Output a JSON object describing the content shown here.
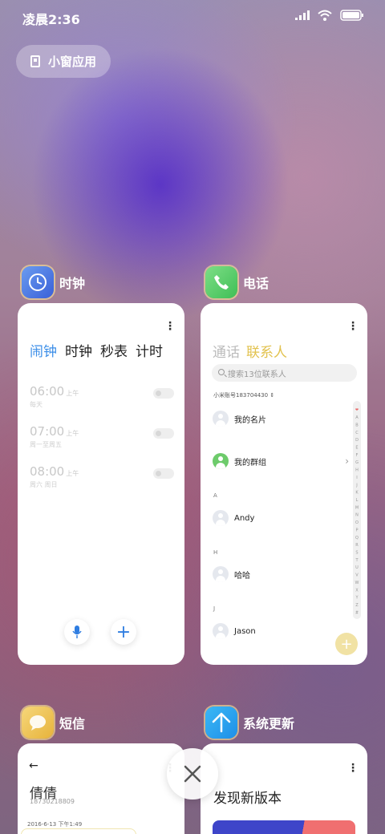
{
  "status": {
    "time": "凌晨2:36",
    "icons": [
      "signal-icon",
      "wifi-icon",
      "battery-icon"
    ]
  },
  "float_window": {
    "label": "小窗应用",
    "icon": "window-icon"
  },
  "apps": {
    "clock": {
      "name": "时钟",
      "icon": "clock-icon",
      "tabs": [
        "闹钟",
        "时钟",
        "秒表",
        "计时"
      ],
      "active_tab": "闹钟",
      "alarms": [
        {
          "time": "06:00",
          "ampm": "上午",
          "repeat": "每天",
          "enabled": false
        },
        {
          "time": "07:00",
          "ampm": "上午",
          "repeat": "周一至周五",
          "enabled": false
        },
        {
          "time": "08:00",
          "ampm": "上午",
          "repeat": "周六 周日",
          "enabled": false
        }
      ],
      "buttons": {
        "voice": "microphone-icon",
        "add": "+"
      }
    },
    "phone": {
      "name": "电话",
      "icon": "phone-icon",
      "tabs": [
        "通话",
        "联系人"
      ],
      "active_tab": "联系人",
      "search_placeholder": "搜索13位联系人",
      "account": "小米账号183704430",
      "rows": {
        "my_card": "我的名片",
        "my_groups": "我的群组",
        "section_a": "A",
        "andy": "Andy",
        "section_h": "H",
        "haha": "哈哈",
        "section_j": "J",
        "jason": "Jason"
      },
      "index_letters": [
        "❤",
        "A",
        "B",
        "C",
        "D",
        "E",
        "F",
        "G",
        "H",
        "I",
        "J",
        "K",
        "L",
        "M",
        "N",
        "O",
        "P",
        "Q",
        "R",
        "S",
        "T",
        "U",
        "V",
        "W",
        "X",
        "Y",
        "Z",
        "#"
      ],
      "fab": "+"
    },
    "sms": {
      "name": "短信",
      "icon": "message-icon",
      "back": "←",
      "contact": "倩倩",
      "number": "18730218809",
      "timestamp": "2016-6-13 下午1:49"
    },
    "update": {
      "name": "系统更新",
      "icon": "update-arrow-icon",
      "title": "发现新版本"
    }
  },
  "close_button": {
    "icon": "close-icon"
  },
  "colors": {
    "accent_blue": "#3b8ee8",
    "contacts_yellow": "#e2c24e",
    "group_green": "#6dcb6b"
  }
}
